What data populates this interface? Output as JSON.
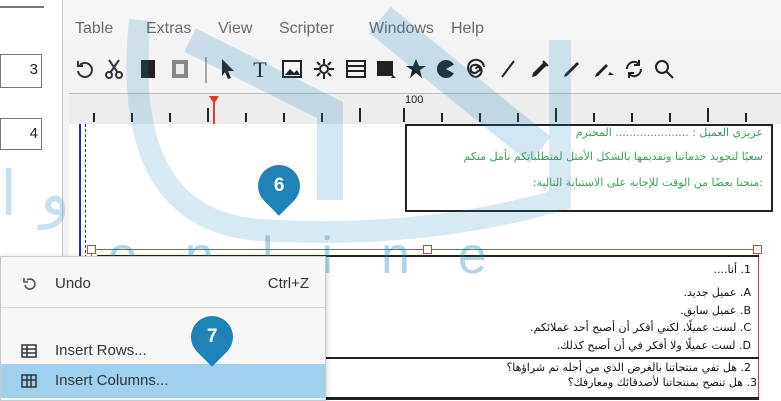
{
  "previous_panel": {
    "values": [
      "3",
      "4"
    ]
  },
  "menubar": {
    "items": [
      "Table",
      "Extras",
      "View",
      "Scripter",
      "Windows",
      "Help"
    ]
  },
  "toolbar": {
    "icons": [
      "redo-icon",
      "cut-icon",
      "page-icon",
      "page-layout-icon",
      "select-arrow-icon",
      "text-frame-icon",
      "image-frame-icon",
      "render-frame-icon",
      "table-icon",
      "shape-icon",
      "star-icon",
      "arc-icon",
      "spiral-icon",
      "line-icon",
      "bezier-icon",
      "freehand-icon",
      "calligraphy-icon",
      "rotate-icon",
      "zoom-icon"
    ]
  },
  "ruler": {
    "label": "100"
  },
  "document": {
    "header_box": {
      "line1": "عزيزي العميل : ..................... المحترم",
      "line2": "سعيًا لتجويد خدماتنا وتقديمها بالشكل الأمثل لمتطلباتكم نأمل منكم",
      "line3": ":منحنا بعضًا من الوقت للإجابة على الاستبانة التالية:"
    },
    "questions": [
      "1. أنا....",
      "A. عميل جديد.",
      "B. عميل سابق.",
      "C. لست عميلًا، لكني أفكر أن أصبح أحد عملائكم.",
      "D. لست عميلًا ولا أفكر في أن أصبح كذلك.",
      "2. هل تفي منتجاتنا بالغرض الذي من أجله تم شراؤها؟",
      "3. هل تنصح بمنتجاتنا لأصدقائك ومعارفك؟"
    ]
  },
  "context_menu": {
    "items": [
      {
        "label": "Undo",
        "shortcut": "Ctrl+Z",
        "icon": "undo-icon"
      },
      {
        "label": "Insert Rows...",
        "shortcut": "",
        "icon": "insert-rows-icon"
      },
      {
        "label": "Insert Columns...",
        "shortcut": "",
        "icon": "insert-columns-icon"
      }
    ]
  },
  "steps": {
    "step6": "6",
    "step7": "7"
  },
  "watermark": {
    "text": "online"
  },
  "colors": {
    "accent": "#1f83b8",
    "highlight": "#9fd1ee",
    "selection": "#e23b3b",
    "doc_green": "#3aa05a",
    "guide_blue": "#1d2fb0"
  }
}
